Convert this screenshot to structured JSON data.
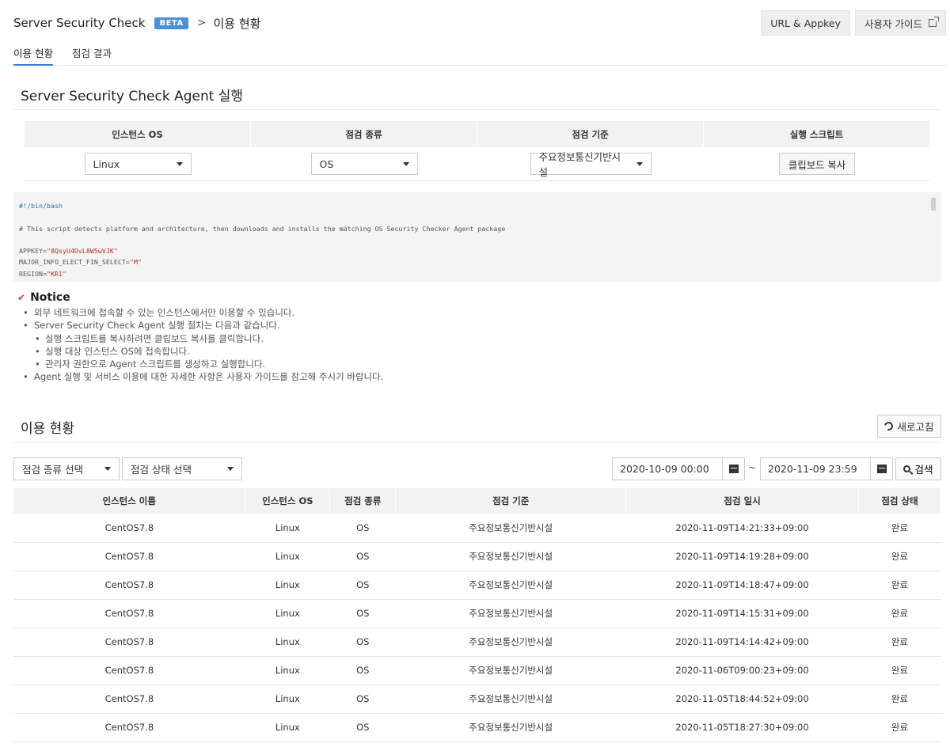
{
  "header": {
    "app_title": "Server Security Check",
    "badge": "BETA",
    "breadcrumb_separator": ">",
    "breadcrumb_current": "이용 현황",
    "url_appkey_label": "URL & Appkey",
    "user_guide_label": "사용자 가이드"
  },
  "tabs": [
    {
      "label": "이용 현황",
      "active": true
    },
    {
      "label": "점검 결과",
      "active": false
    }
  ],
  "agent_section": {
    "title": "Server Security Check Agent 실행",
    "columns": [
      "인스턴스 OS",
      "점검 종류",
      "점검 기준",
      "실행 스크립트"
    ],
    "os_select": "Linux",
    "type_select": "OS",
    "standard_select": "주요정보통신기반시설",
    "copy_button": "클립보드 복사"
  },
  "script": {
    "shebang": "#!/bin/bash",
    "comment": "# This script detects platform and architecture, then downloads and installs the matching OS Security Checker Agent package",
    "vars": [
      {
        "name": "APPKEY=",
        "value": "\"8QsyU4DvL8W5wVJK\""
      },
      {
        "name": "MAJOR_INFO_ELECT_FIN_SELECT=",
        "value": "\"M\""
      },
      {
        "name": "REGION=",
        "value": "\"KR1\""
      }
    ]
  },
  "notice": {
    "title": "Notice",
    "items": [
      "외부 네트워크에 접속할 수 있는 인스턴스에서만 이용할 수 있습니다.",
      "Server Security Check Agent 실행 절차는 다음과 같습니다.",
      "실행 스크립트를 복사하려면 클립보드 복사를 클릭합니다.",
      "실행 대상 인스턴스 OS에 접속합니다.",
      "관리자 권한으로 Agent 스크립트를 생성하고 실행합니다.",
      "Agent 실행 및 서비스 이용에 대한 자세한 사항은 사용자 가이드를 참고해 주시기 바랍니다."
    ]
  },
  "usage_section": {
    "title": "이용 현황",
    "refresh_label": "새로고침",
    "filter_type_placeholder": "점검 종류 선택",
    "filter_status_placeholder": "점검 상태 선택",
    "date_from": "2020-10-09 00:00",
    "date_separator": "~",
    "date_to": "2020-11-09 23:59",
    "search_label": "검색"
  },
  "results": {
    "columns": [
      "인스턴스 이름",
      "인스턴스 OS",
      "점검 종류",
      "점검 기준",
      "점검 일시",
      "점검 상태"
    ],
    "rows": [
      [
        "CentOS7.8",
        "Linux",
        "OS",
        "주요정보통신기반시설",
        "2020-11-09T14:21:33+09:00",
        "완료"
      ],
      [
        "CentOS7.8",
        "Linux",
        "OS",
        "주요정보통신기반시설",
        "2020-11-09T14:19:28+09:00",
        "완료"
      ],
      [
        "CentOS7.8",
        "Linux",
        "OS",
        "주요정보통신기반시설",
        "2020-11-09T14:18:47+09:00",
        "완료"
      ],
      [
        "CentOS7.8",
        "Linux",
        "OS",
        "주요정보통신기반시설",
        "2020-11-09T14:15:31+09:00",
        "완료"
      ],
      [
        "CentOS7.8",
        "Linux",
        "OS",
        "주요정보통신기반시설",
        "2020-11-09T14:14:42+09:00",
        "완료"
      ],
      [
        "CentOS7.8",
        "Linux",
        "OS",
        "주요정보통신기반시설",
        "2020-11-06T09:00:23+09:00",
        "완료"
      ],
      [
        "CentOS7.8",
        "Linux",
        "OS",
        "주요정보통신기반시설",
        "2020-11-05T18:44:52+09:00",
        "완료"
      ],
      [
        "CentOS7.8",
        "Linux",
        "OS",
        "주요정보통신기반시설",
        "2020-11-05T18:27:30+09:00",
        "완료"
      ]
    ]
  },
  "colors": {
    "accent": "#3d7bd9",
    "badge": "#4a90d9",
    "notice_check": "#d04030"
  }
}
